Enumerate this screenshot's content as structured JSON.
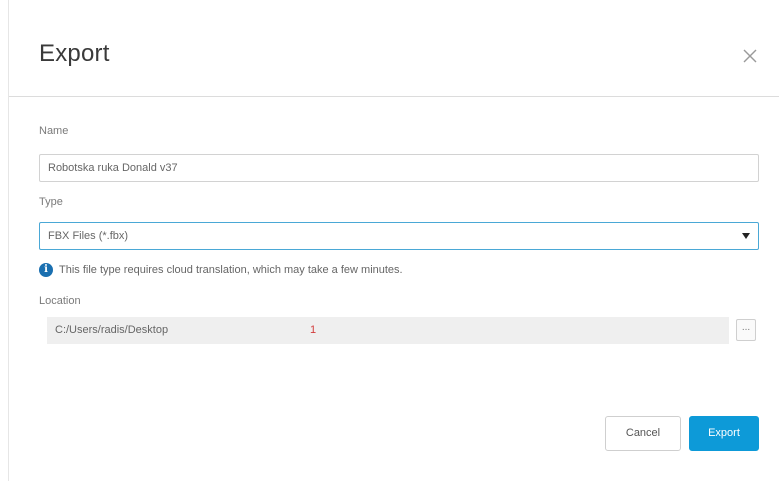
{
  "dialog": {
    "title": "Export",
    "close_icon": "close-icon"
  },
  "name": {
    "label": "Name",
    "value": "Robotska ruka Donald v37"
  },
  "type": {
    "label": "Type",
    "selected": "FBX Files (*.fbx)",
    "info_icon": "info-icon",
    "info_text": "This file type requires cloud translation, which may take a few minutes."
  },
  "location": {
    "label": "Location",
    "path": "C:/Users/radis/Desktop",
    "marker": "1",
    "browse_label": "..."
  },
  "buttons": {
    "cancel": "Cancel",
    "export": "Export"
  },
  "colors": {
    "accent": "#0d9ad8",
    "info": "#1a6fb0",
    "marker": "#d23b3b"
  }
}
